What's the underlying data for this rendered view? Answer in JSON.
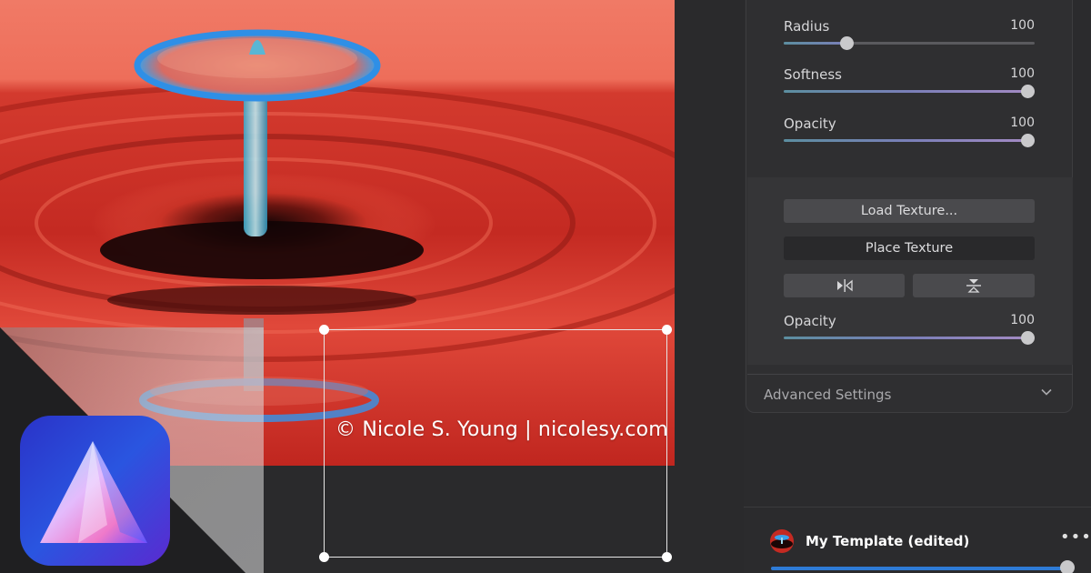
{
  "canvas": {
    "watermark_text": "© Nicole S. Young | nicolesy.com"
  },
  "panel": {
    "sliders": [
      {
        "label": "Radius",
        "value": "100",
        "level": 0.25
      },
      {
        "label": "Softness",
        "value": "100",
        "level": 1.0
      },
      {
        "label": "Opacity",
        "value": "100",
        "level": 1.0
      }
    ],
    "texture": {
      "load_label": "Load Texture...",
      "place_label": "Place Texture",
      "flip_horizontal_icon": "flip-horizontal-icon",
      "flip_vertical_icon": "flip-vertical-icon",
      "opacity_label": "Opacity",
      "opacity_value": "100",
      "opacity_level": 1.0
    },
    "advanced": {
      "label": "Advanced Settings",
      "icon": "chevron-down-icon"
    },
    "template": {
      "name": "My Template (edited)",
      "more_icon": "more-icon",
      "amount_level": 1.0
    }
  },
  "colors": {
    "panel_bg": "#2b2b2d",
    "accent_blue": "#2e7bd6",
    "photo_red": "#d0302a"
  }
}
